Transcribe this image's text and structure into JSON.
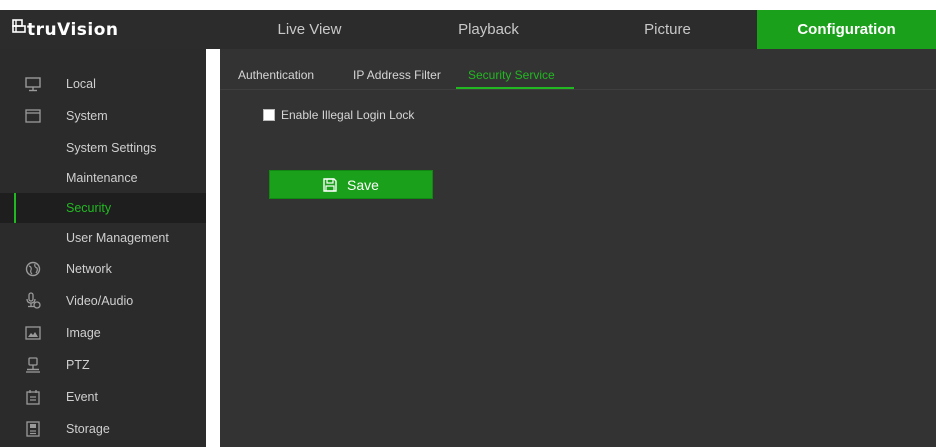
{
  "brand": {
    "logo_text": "truVision"
  },
  "top_nav": {
    "items": [
      {
        "label": "Live View"
      },
      {
        "label": "Playback"
      },
      {
        "label": "Picture"
      },
      {
        "label": "Configuration",
        "active": true
      }
    ]
  },
  "sidebar": {
    "items": [
      {
        "label": "Local",
        "icon": "monitor-icon"
      },
      {
        "label": "System",
        "icon": "window-icon"
      },
      {
        "label": "System Settings"
      },
      {
        "label": "Maintenance"
      },
      {
        "label": "Security",
        "active": true
      },
      {
        "label": "User Management"
      },
      {
        "label": "Network",
        "icon": "globe-icon"
      },
      {
        "label": "Video/Audio",
        "icon": "microphone-icon"
      },
      {
        "label": "Image",
        "icon": "image-icon"
      },
      {
        "label": "PTZ",
        "icon": "ptz-camera-icon"
      },
      {
        "label": "Event",
        "icon": "calendar-icon"
      },
      {
        "label": "Storage",
        "icon": "storage-icon"
      }
    ]
  },
  "tabs": {
    "items": [
      {
        "label": "Authentication"
      },
      {
        "label": "IP Address Filter"
      },
      {
        "label": "Security Service",
        "active": true
      }
    ]
  },
  "form": {
    "illegal_login_lock_label": "Enable Illegal Login Lock",
    "illegal_login_lock_checked": false,
    "save_label": "Save"
  },
  "colors": {
    "accent": "#1aa01a",
    "active_text": "#22b822",
    "topbar_bg": "#2c2c2c",
    "sidebar_bg": "#2b2b2b",
    "content_bg": "#333333"
  }
}
